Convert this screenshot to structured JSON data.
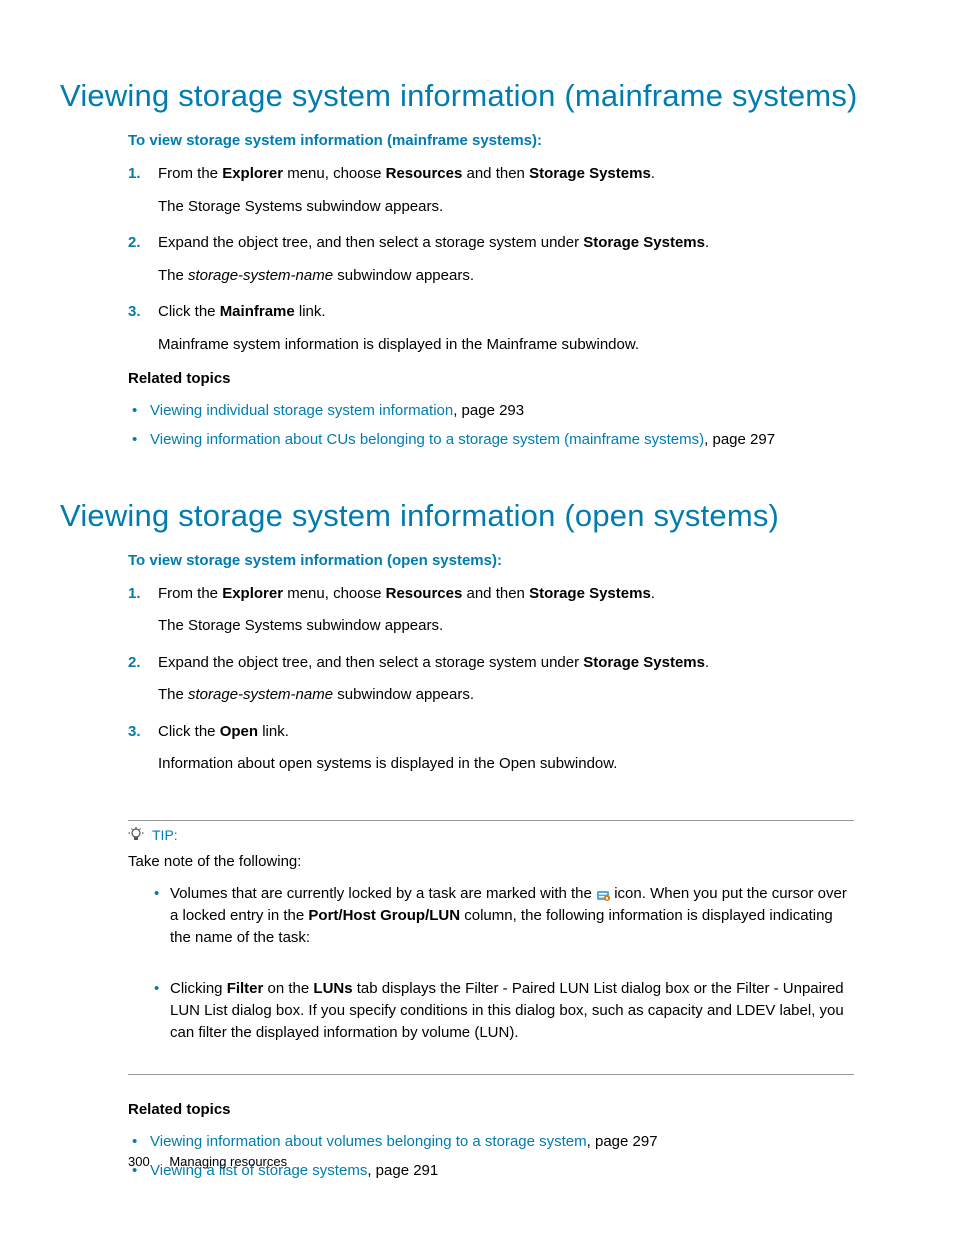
{
  "section1": {
    "heading": "Viewing storage system information (mainframe systems)",
    "procTitle": "To view storage system information (mainframe systems):",
    "steps": {
      "s1a": "From the ",
      "s1b": "Explorer",
      "s1c": " menu, choose ",
      "s1d": "Resources",
      "s1e": " and then ",
      "s1f": "Storage Systems",
      "s1g": ".",
      "s1sub": "The Storage Systems subwindow appears.",
      "s2a": "Expand the object tree, and then select a storage system under ",
      "s2b": "Storage Systems",
      "s2c": ".",
      "s2subA": "The ",
      "s2subB": "storage-system-name",
      "s2subC": " subwindow appears.",
      "s3a": "Click the ",
      "s3b": "Mainframe",
      "s3c": " link.",
      "s3sub": "Mainframe system information is displayed in the Mainframe subwindow."
    },
    "relatedHeading": "Related topics",
    "rel1a": "Viewing individual storage system information",
    "rel1b": ", page 293",
    "rel2a": "Viewing information about CUs belonging to a storage system (mainframe systems)",
    "rel2b": ", page 297"
  },
  "section2": {
    "heading": "Viewing storage system information (open systems)",
    "procTitle": "To view storage system information (open systems):",
    "steps": {
      "s1a": "From the ",
      "s1b": "Explorer",
      "s1c": " menu, choose ",
      "s1d": "Resources",
      "s1e": " and then ",
      "s1f": "Storage Systems",
      "s1g": ".",
      "s1sub": "The Storage Systems subwindow appears.",
      "s2a": "Expand the object tree, and then select a storage system under ",
      "s2b": "Storage Systems",
      "s2c": ".",
      "s2subA": "The ",
      "s2subB": "storage-system-name",
      "s2subC": " subwindow appears.",
      "s3a": "Click the ",
      "s3b": "Open",
      "s3c": " link.",
      "s3sub": "Information about open systems is displayed in the Open subwindow."
    }
  },
  "tip": {
    "label": "TIP:",
    "intro": "Take note of the following:",
    "b1a": "Volumes that are currently locked by a task are marked with the ",
    "b1b": " icon. When you put the cursor over a locked entry in the ",
    "b1c": "Port/Host Group/LUN",
    "b1d": " column, the following information is displayed indicating the name of the task:",
    "b2a": "Clicking ",
    "b2b": "Filter",
    "b2c": " on the ",
    "b2d": "LUNs",
    "b2e": " tab displays the Filter - Paired LUN List dialog box or the Filter - Unpaired LUN List dialog box. If you specify conditions in this dialog box, such as capacity and LDEV label, you can filter the displayed information by volume (LUN)."
  },
  "related2": {
    "heading": "Related topics",
    "r1a": "Viewing information about volumes belonging to a storage system",
    "r1b": ", page 297",
    "r2a": "Viewing a list of storage systems",
    "r2b": ", page 291"
  },
  "footer": {
    "page": "300",
    "title": "Managing resources"
  }
}
